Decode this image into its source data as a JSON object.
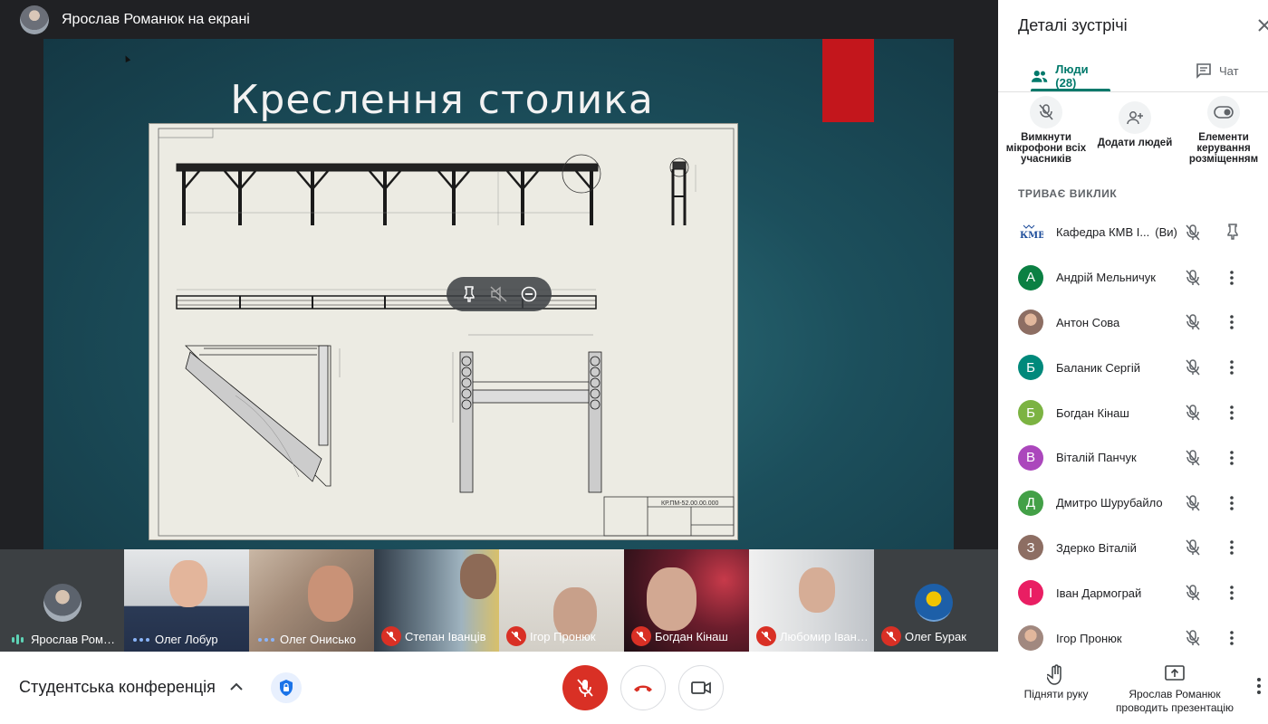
{
  "presenter_banner": {
    "text": "Ярослав Романюк на екрані"
  },
  "slide": {
    "title": "Креслення столика",
    "title_block_code": "КР.ПМ-52.00.00.000"
  },
  "tile_controls": {
    "icons": [
      "pin-icon",
      "mute-icon",
      "remove-icon"
    ]
  },
  "filmstrip": [
    {
      "name": "Ярослав Рома…",
      "state": "speaking-bars",
      "kind": "avatar"
    },
    {
      "name": "Олег Лобур",
      "state": "speaking-dots",
      "kind": "video",
      "bg": "#cfd2d6"
    },
    {
      "name": "Олег Онисько",
      "state": "speaking-dots",
      "kind": "video",
      "bg": "#8a7565"
    },
    {
      "name": "Степан Іванців",
      "state": "muted",
      "kind": "video",
      "bg": "#4d5a6a"
    },
    {
      "name": "Ігор Пронюк",
      "state": "muted",
      "kind": "video",
      "bg": "#d9d6cf"
    },
    {
      "name": "Богдан Кінаш",
      "state": "muted",
      "kind": "video",
      "bg": "#5a2230"
    },
    {
      "name": "Любомир Іван…",
      "state": "muted",
      "kind": "video",
      "bg": "#e2e4e6"
    },
    {
      "name": "Олег Бурак",
      "state": "muted",
      "kind": "avatar"
    }
  ],
  "bottom_bar": {
    "meeting_name": "Студентська конференція",
    "raise_hand_label": "Підняти руку",
    "presenting_label": "Ярослав Романюк проводить презентацію"
  },
  "panel": {
    "title": "Деталі зустрічі",
    "tab_people": "Люди (28)",
    "tab_chat": "Чат",
    "action_mute_all": "Вимкнути мікрофони всіх учасників",
    "action_add": "Додати людей",
    "action_layout": "Елементи керування розміщенням",
    "section_label": "ТРИВАЄ ВИКЛИК",
    "people": [
      {
        "name": "Кафедра КМВ І...",
        "suffix": "(Ви)",
        "initial": "",
        "color": "#ffffff",
        "avatar": "logo"
      },
      {
        "name": "Андрій Мельничук",
        "initial": "А",
        "color": "#0b8043",
        "avatar": "letter"
      },
      {
        "name": "Антон Сова",
        "initial": "",
        "color": "#8d6e63",
        "avatar": "photo"
      },
      {
        "name": "Баланик Сергій",
        "initial": "Б",
        "color": "#00897b",
        "avatar": "letter"
      },
      {
        "name": "Богдан Кінаш",
        "initial": "Б",
        "color": "#7cb342",
        "avatar": "letter"
      },
      {
        "name": "Віталій Панчук",
        "initial": "В",
        "color": "#ab47bc",
        "avatar": "letter"
      },
      {
        "name": "Дмитро Шурубайло",
        "initial": "Д",
        "color": "#43a047",
        "avatar": "letter"
      },
      {
        "name": "Здерко Віталій",
        "initial": "З",
        "color": "#8d6e63",
        "avatar": "letter"
      },
      {
        "name": "Іван Дармограй",
        "initial": "І",
        "color": "#e91e63",
        "avatar": "letter"
      },
      {
        "name": "Ігор Пронюк",
        "initial": "",
        "color": "#a1887f",
        "avatar": "photo"
      }
    ]
  }
}
